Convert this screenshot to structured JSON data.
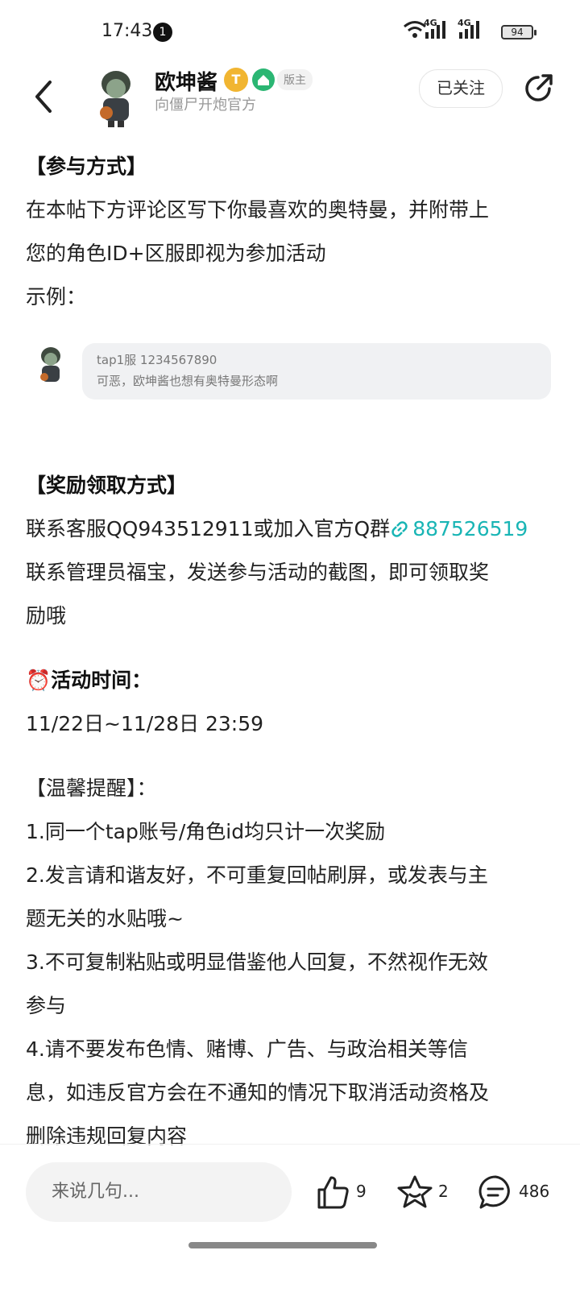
{
  "status": {
    "time": "17:43",
    "notifications": "1",
    "battery": "94",
    "network": "4G"
  },
  "header": {
    "author": "欧坤酱",
    "badge_level": "T",
    "role": "版主",
    "subtitle": "向僵尸开炮官方",
    "follow_label": "已关注"
  },
  "post": {
    "participation": {
      "heading": "【参与方式】",
      "lines": [
        "在本帖下方评论区写下你最喜欢的奥特曼，并附带上",
        "您的角色ID+区服即视为参加活动",
        "示例："
      ]
    },
    "example": {
      "line1": "tap1服  1234567890",
      "line2": "可恶，欧坤酱也想有奥特曼形态啊"
    },
    "reward": {
      "heading": "【奖励领取方式】",
      "contact_prefix": "联系客服QQ943512911或加入官方Q群",
      "group_link": "887526519",
      "lines": [
        "联系管理员福宝，发送参与活动的截图，即可领取奖",
        "励哦"
      ]
    },
    "time": {
      "icon": "⏰",
      "heading": "活动时间：",
      "range": "11/22日~11/28日 23:59"
    },
    "tips": {
      "heading": "【温馨提醒】：",
      "lines": [
        "1.同一个tap账号/角色id均只计一次奖励",
        "2.发言请和谐友好，不可重复回帖刷屏，或发表与主",
        "题无关的水贴哦~",
        "3.不可复制粘贴或明显借鉴他人回复，不然视作无效",
        "参与",
        "4.请不要发布色情、赌博、广告、与政治相关等信",
        "息，如违反官方会在不通知的情况下取消活动资格及",
        "删除违规回复内容"
      ]
    }
  },
  "bottom": {
    "comment_placeholder": "来说几句...",
    "likes": "9",
    "favorites": "2",
    "comments": "486"
  }
}
